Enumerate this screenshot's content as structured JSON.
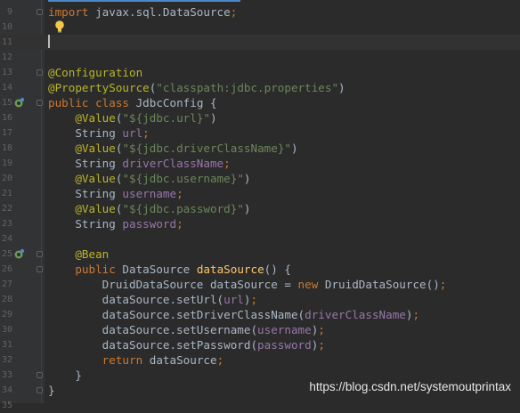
{
  "editor": {
    "lines": [
      {
        "num": "9",
        "tokens": [
          {
            "t": "import ",
            "c": "kw"
          },
          {
            "t": "javax.sql.DataSource",
            "c": ""
          },
          {
            "t": ";",
            "c": "kw"
          }
        ]
      },
      {
        "num": "10",
        "tokens": []
      },
      {
        "num": "11",
        "tokens": [],
        "current": true
      },
      {
        "num": "12",
        "tokens": []
      },
      {
        "num": "13",
        "tokens": [
          {
            "t": "@Configuration",
            "c": "ann"
          }
        ]
      },
      {
        "num": "14",
        "tokens": [
          {
            "t": "@PropertySource",
            "c": "ann"
          },
          {
            "t": "(",
            "c": ""
          },
          {
            "t": "\"classpath:jdbc.properties\"",
            "c": "str"
          },
          {
            "t": ")",
            "c": ""
          }
        ]
      },
      {
        "num": "15",
        "tokens": [
          {
            "t": "public class ",
            "c": "kw"
          },
          {
            "t": "JdbcConfig {",
            "c": ""
          }
        ],
        "icon": "spring-bean-icon"
      },
      {
        "num": "16",
        "tokens": [
          {
            "t": "    ",
            "c": ""
          },
          {
            "t": "@Value",
            "c": "ann"
          },
          {
            "t": "(",
            "c": ""
          },
          {
            "t": "\"${jdbc.url}\"",
            "c": "str"
          },
          {
            "t": ")",
            "c": ""
          }
        ]
      },
      {
        "num": "17",
        "tokens": [
          {
            "t": "    String ",
            "c": ""
          },
          {
            "t": "url",
            "c": "fld"
          },
          {
            "t": ";",
            "c": "kw"
          }
        ]
      },
      {
        "num": "18",
        "tokens": [
          {
            "t": "    ",
            "c": ""
          },
          {
            "t": "@Value",
            "c": "ann"
          },
          {
            "t": "(",
            "c": ""
          },
          {
            "t": "\"${jdbc.driverClassName}\"",
            "c": "str"
          },
          {
            "t": ")",
            "c": ""
          }
        ]
      },
      {
        "num": "19",
        "tokens": [
          {
            "t": "    String ",
            "c": ""
          },
          {
            "t": "driverClassName",
            "c": "fld"
          },
          {
            "t": ";",
            "c": "kw"
          }
        ]
      },
      {
        "num": "20",
        "tokens": [
          {
            "t": "    ",
            "c": ""
          },
          {
            "t": "@Value",
            "c": "ann"
          },
          {
            "t": "(",
            "c": ""
          },
          {
            "t": "\"${jdbc.username}\"",
            "c": "str"
          },
          {
            "t": ")",
            "c": ""
          }
        ]
      },
      {
        "num": "21",
        "tokens": [
          {
            "t": "    String ",
            "c": ""
          },
          {
            "t": "username",
            "c": "fld"
          },
          {
            "t": ";",
            "c": "kw"
          }
        ]
      },
      {
        "num": "22",
        "tokens": [
          {
            "t": "    ",
            "c": ""
          },
          {
            "t": "@Value",
            "c": "ann"
          },
          {
            "t": "(",
            "c": ""
          },
          {
            "t": "\"${jdbc.password}\"",
            "c": "str"
          },
          {
            "t": ")",
            "c": ""
          }
        ]
      },
      {
        "num": "23",
        "tokens": [
          {
            "t": "    String ",
            "c": ""
          },
          {
            "t": "password",
            "c": "fld"
          },
          {
            "t": ";",
            "c": "kw"
          }
        ]
      },
      {
        "num": "24",
        "tokens": []
      },
      {
        "num": "25",
        "tokens": [
          {
            "t": "    ",
            "c": ""
          },
          {
            "t": "@Bean",
            "c": "ann"
          }
        ],
        "icon": "bean-method-icon"
      },
      {
        "num": "26",
        "tokens": [
          {
            "t": "    ",
            "c": ""
          },
          {
            "t": "public ",
            "c": "kw"
          },
          {
            "t": "DataSource ",
            "c": ""
          },
          {
            "t": "dataSource",
            "c": "fn"
          },
          {
            "t": "() {",
            "c": ""
          }
        ]
      },
      {
        "num": "27",
        "tokens": [
          {
            "t": "        DruidDataSource dataSource = ",
            "c": ""
          },
          {
            "t": "new ",
            "c": "kw"
          },
          {
            "t": "DruidDataSource()",
            "c": ""
          },
          {
            "t": ";",
            "c": "kw"
          }
        ]
      },
      {
        "num": "28",
        "tokens": [
          {
            "t": "        dataSource.setUrl(",
            "c": ""
          },
          {
            "t": "url",
            "c": "fld"
          },
          {
            "t": ")",
            "c": ""
          },
          {
            "t": ";",
            "c": "kw"
          }
        ]
      },
      {
        "num": "29",
        "tokens": [
          {
            "t": "        dataSource.setDriverClassName(",
            "c": ""
          },
          {
            "t": "driverClassName",
            "c": "fld"
          },
          {
            "t": ")",
            "c": ""
          },
          {
            "t": ";",
            "c": "kw"
          }
        ]
      },
      {
        "num": "30",
        "tokens": [
          {
            "t": "        dataSource.setUsername(",
            "c": ""
          },
          {
            "t": "username",
            "c": "fld"
          },
          {
            "t": ")",
            "c": ""
          },
          {
            "t": ";",
            "c": "kw"
          }
        ]
      },
      {
        "num": "31",
        "tokens": [
          {
            "t": "        dataSource.setPassword(",
            "c": ""
          },
          {
            "t": "password",
            "c": "fld"
          },
          {
            "t": ")",
            "c": ""
          },
          {
            "t": ";",
            "c": "kw"
          }
        ]
      },
      {
        "num": "32",
        "tokens": [
          {
            "t": "        ",
            "c": ""
          },
          {
            "t": "return ",
            "c": "kw"
          },
          {
            "t": "dataSource",
            "c": ""
          },
          {
            "t": ";",
            "c": "kw"
          }
        ]
      },
      {
        "num": "33",
        "tokens": [
          {
            "t": "    }",
            "c": ""
          }
        ]
      },
      {
        "num": "34",
        "tokens": [
          {
            "t": "}",
            "c": ""
          }
        ]
      },
      {
        "num": "35",
        "tokens": []
      }
    ],
    "fold_markers_on_lines": [
      "9",
      "13",
      "15",
      "25",
      "26",
      "33",
      "34"
    ],
    "intention_icon": "lightbulb-icon"
  },
  "watermark": "https://blog.csdn.net/systemoutprintax",
  "colors": {
    "background": "#2b2b2b",
    "gutter": "#313335",
    "keyword": "#cc7832",
    "annotation": "#bbb529",
    "string": "#6a8759",
    "field": "#9876aa",
    "method": "#ffc66d",
    "text": "#a9b7c6"
  }
}
